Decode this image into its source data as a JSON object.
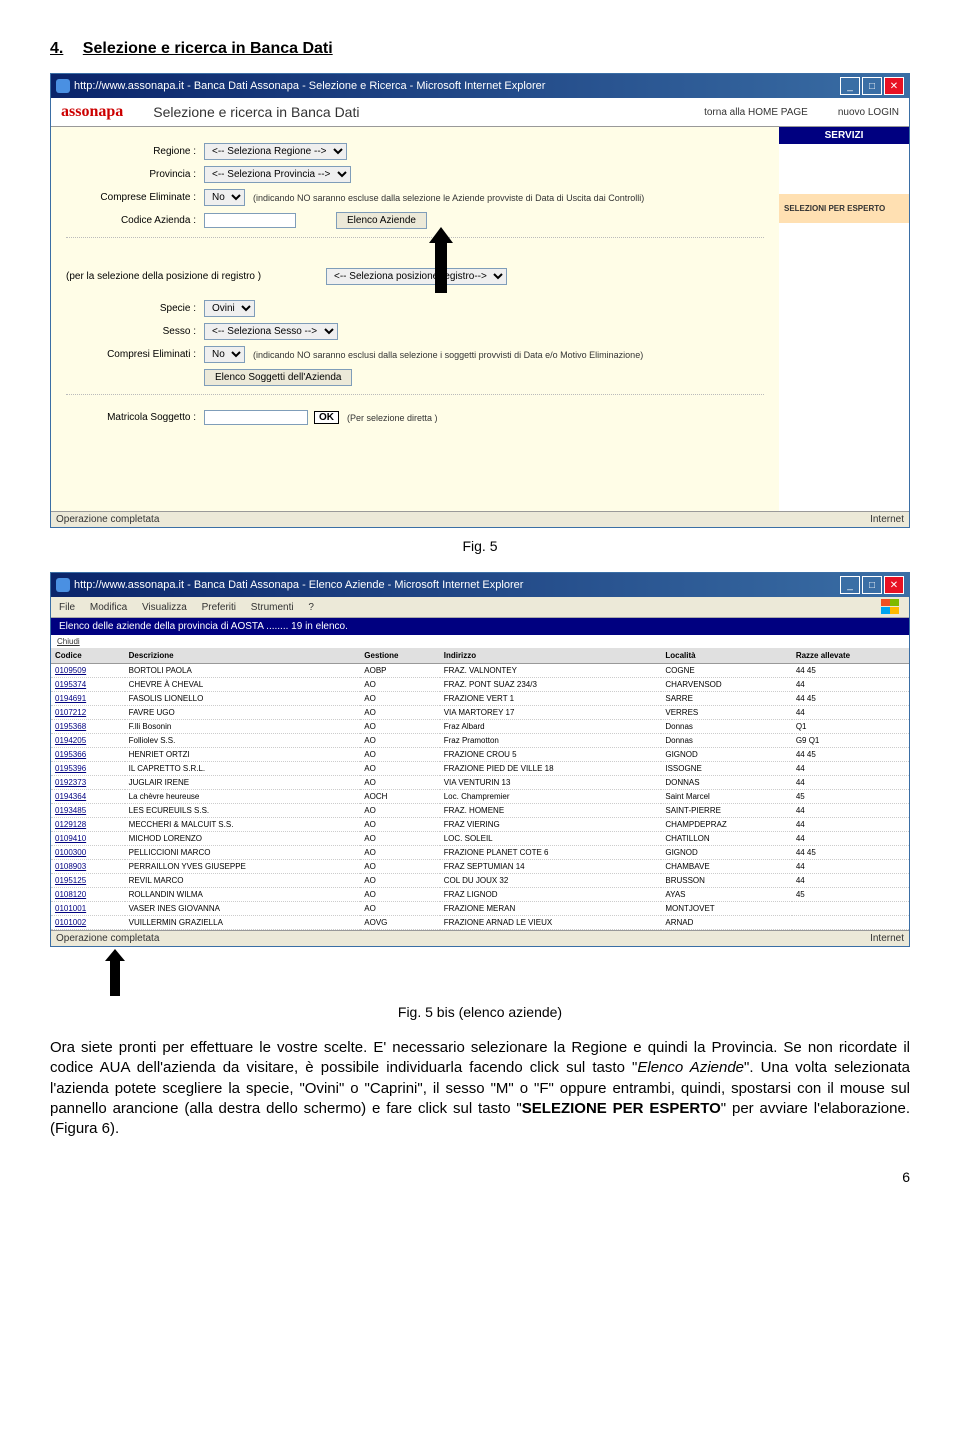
{
  "heading": {
    "num": "4.",
    "text": "Selezione e ricerca in Banca Dati"
  },
  "win1": {
    "title": "http://www.assonapa.it - Banca Dati Assonapa - Selezione e Ricerca - Microsoft Internet Explorer",
    "header_title": "Selezione e ricerca in Banca Dati",
    "home_link": "torna alla HOME PAGE",
    "login_link": "nuovo LOGIN",
    "sidebar": {
      "servizi": "SERVIZI",
      "sel_esperto": "SELEZIONI PER ESPERTO"
    },
    "form": {
      "regione_label": "Regione :",
      "regione_val": "<-- Seleziona Regione -->",
      "provincia_label": "Provincia :",
      "provincia_val": "<-- Seleziona Provincia -->",
      "comprese_label": "Comprese Eliminate :",
      "comprese_val": "No",
      "comprese_note": "(indicando NO saranno escluse dalla selezione le Aziende provviste di Data di Uscita dai Controlli)",
      "codazienda_label": "Codice Azienda :",
      "elenco_btn": "Elenco Aziende",
      "registro_prefix": "(per la selezione della posizione di registro )",
      "registro_val": "<-- Seleziona posizione registro-->",
      "specie_label": "Specie :",
      "specie_val": "Ovini",
      "sesso_label": "Sesso :",
      "sesso_val": "<-- Seleziona Sesso -->",
      "compresi_label": "Compresi Eliminati :",
      "compresi_val": "No",
      "compresi_note": "(indicando NO saranno esclusi dalla selezione i soggetti provvisti di Data e/o Motivo Eliminazione)",
      "elenco_sogg_btn": "Elenco Soggetti dell'Azienda",
      "matricola_label": "Matricola Soggetto :",
      "ok_btn": "OK",
      "matricola_note": "(Per selezione diretta )"
    },
    "status_left": "Operazione completata",
    "status_right": "Internet"
  },
  "fig5_caption": "Fig. 5",
  "win2": {
    "title": "http://www.assonapa.it - Banca Dati Assonapa - Elenco Aziende - Microsoft Internet Explorer",
    "menu": {
      "file": "File",
      "modifica": "Modifica",
      "visualizza": "Visualizza",
      "preferiti": "Preferiti",
      "strumenti": "Strumenti",
      "help": "?"
    },
    "bluebar": "Elenco delle aziende della provincia di AOSTA ........ 19 in elenco.",
    "chiudi": "Chiudi",
    "columns": [
      "Codice",
      "Descrizione",
      "Gestione",
      "Indirizzo",
      "Località",
      "Razze allevate"
    ],
    "rows": [
      {
        "c": "0109509",
        "d": "BORTOLI PAOLA",
        "g": "AOBP",
        "i": "FRAZ. VALNONTEY",
        "l": "COGNE",
        "r": "44  45"
      },
      {
        "c": "0195374",
        "d": "CHEVRE À CHEVAL",
        "g": "AO",
        "i": "FRAZ. PONT SUAZ 234/3",
        "l": "CHARVENSOD",
        "r": "44"
      },
      {
        "c": "0194691",
        "d": "FASOLIS LIONELLO",
        "g": "AO",
        "i": "FRAZIONE VERT 1",
        "l": "SARRE",
        "r": "44  45"
      },
      {
        "c": "0107212",
        "d": "FAVRE UGO",
        "g": "AO",
        "i": "VIA MARTOREY 17",
        "l": "VERRES",
        "r": "44"
      },
      {
        "c": "0195368",
        "d": "F.lli Bosonin",
        "g": "AO",
        "i": "Fraz Albard",
        "l": "Donnas",
        "r": "Q1"
      },
      {
        "c": "0194205",
        "d": "Folliolev S.S.",
        "g": "AO",
        "i": "Fraz Pramotton",
        "l": "Donnas",
        "r": "G9  Q1"
      },
      {
        "c": "0195366",
        "d": "HENRIET ORTZI",
        "g": "AO",
        "i": "FRAZIONE CROU 5",
        "l": "GIGNOD",
        "r": "44  45"
      },
      {
        "c": "0195396",
        "d": "IL CAPRETTO S.R.L.",
        "g": "AO",
        "i": "FRAZIONE PIED DE VILLE 18",
        "l": "ISSOGNE",
        "r": "44"
      },
      {
        "c": "0192373",
        "d": "JUGLAIR IRENE",
        "g": "AO",
        "i": "VIA VENTURIN 13",
        "l": "DONNAS",
        "r": "44"
      },
      {
        "c": "0194364",
        "d": "La chèvre heureuse",
        "g": "AOCH",
        "i": "Loc. Champremier",
        "l": "Saint Marcel",
        "r": "45"
      },
      {
        "c": "0193485",
        "d": "LES ECUREUILS S.S.",
        "g": "AO",
        "i": "FRAZ. HOMENE",
        "l": "SAINT-PIERRE",
        "r": "44"
      },
      {
        "c": "0129128",
        "d": "MECCHERI & MALCUIT S.S.",
        "g": "AO",
        "i": "FRAZ VIERING",
        "l": "CHAMPDEPRAZ",
        "r": "44"
      },
      {
        "c": "0109410",
        "d": "MICHOD LORENZO",
        "g": "AO",
        "i": "LOC. SOLEIL",
        "l": "CHATILLON",
        "r": "44"
      },
      {
        "c": "0100300",
        "d": "PELLICCIONI MARCO",
        "g": "AO",
        "i": "FRAZIONE PLANET COTE 6",
        "l": "GIGNOD",
        "r": "44  45"
      },
      {
        "c": "0108903",
        "d": "PERRAILLON YVES GIUSEPPE",
        "g": "AO",
        "i": "FRAZ SEPTUMIAN 14",
        "l": "CHAMBAVE",
        "r": "44"
      },
      {
        "c": "0195125",
        "d": "REVIL MARCO",
        "g": "AO",
        "i": "COL DU JOUX 32",
        "l": "BRUSSON",
        "r": "44"
      },
      {
        "c": "0108120",
        "d": "ROLLANDIN WILMA",
        "g": "AO",
        "i": "FRAZ LIGNOD",
        "l": "AYAS",
        "r": "45"
      },
      {
        "c": "0101001",
        "d": "VASER INES GIOVANNA",
        "g": "AO",
        "i": "FRAZIONE MERAN",
        "l": "MONTJOVET",
        "r": ""
      },
      {
        "c": "0101002",
        "d": "VUILLERMIN GRAZIELLA",
        "g": "AOVG",
        "i": "FRAZIONE ARNAD LE VIEUX",
        "l": "ARNAD",
        "r": ""
      }
    ],
    "status_left": "Operazione completata",
    "status_right": "Internet"
  },
  "fig5bis_caption": "Fig. 5 bis (elenco aziende)",
  "bodytext": {
    "p1": "Ora siete pronti per effettuare le vostre scelte. E' necessario selezionare la Regione e quindi la Provincia. Se non ricordate il codice AUA dell'azienda da visitare, è possibile individuarla facendo click sul tasto \"",
    "elenco": "Elenco Aziende",
    "p2": "\". Una volta selezionata l'azienda potete scegliere la specie, \"Ovini\" o \"Caprini\", il sesso \"M\" o \"F\" oppure entrambi, quindi, spostarsi con il mouse sul pannello arancione (alla destra dello schermo) e fare click sul tasto \"",
    "sel": "SELEZIONE PER ESPERTO",
    "p3": "\" per avviare l'elaborazione. (Figura 6)."
  },
  "pagenum": "6"
}
